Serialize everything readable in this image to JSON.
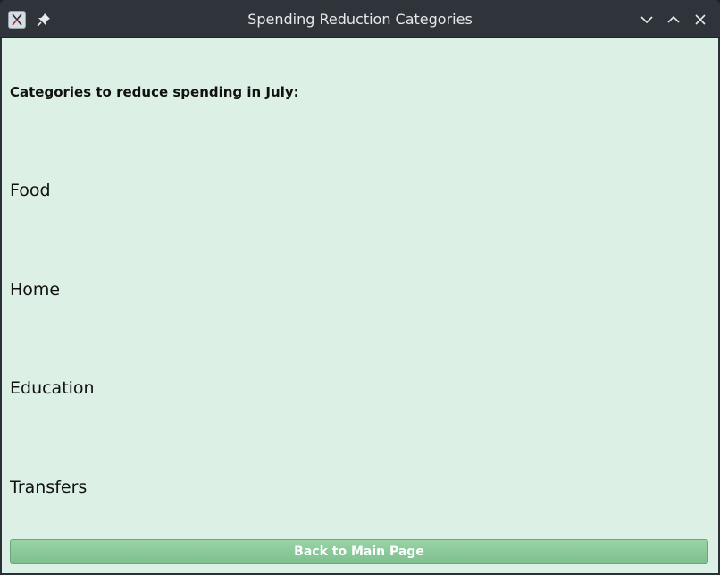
{
  "window": {
    "title": "Spending Reduction Categories",
    "icons": {
      "app": "app-icon",
      "pin": "pin-icon",
      "minimize": "chevron-down-icon",
      "maximize": "chevron-up-icon",
      "close": "close-icon"
    }
  },
  "main": {
    "heading": "Categories to reduce spending in July:",
    "categories": [
      "Food",
      "Home",
      "Education",
      "Transfers"
    ],
    "back_button_label": "Back to Main Page"
  },
  "colors": {
    "background": "#dcf0e6",
    "button": "#8dc99b",
    "titlebar": "#2f343b"
  }
}
